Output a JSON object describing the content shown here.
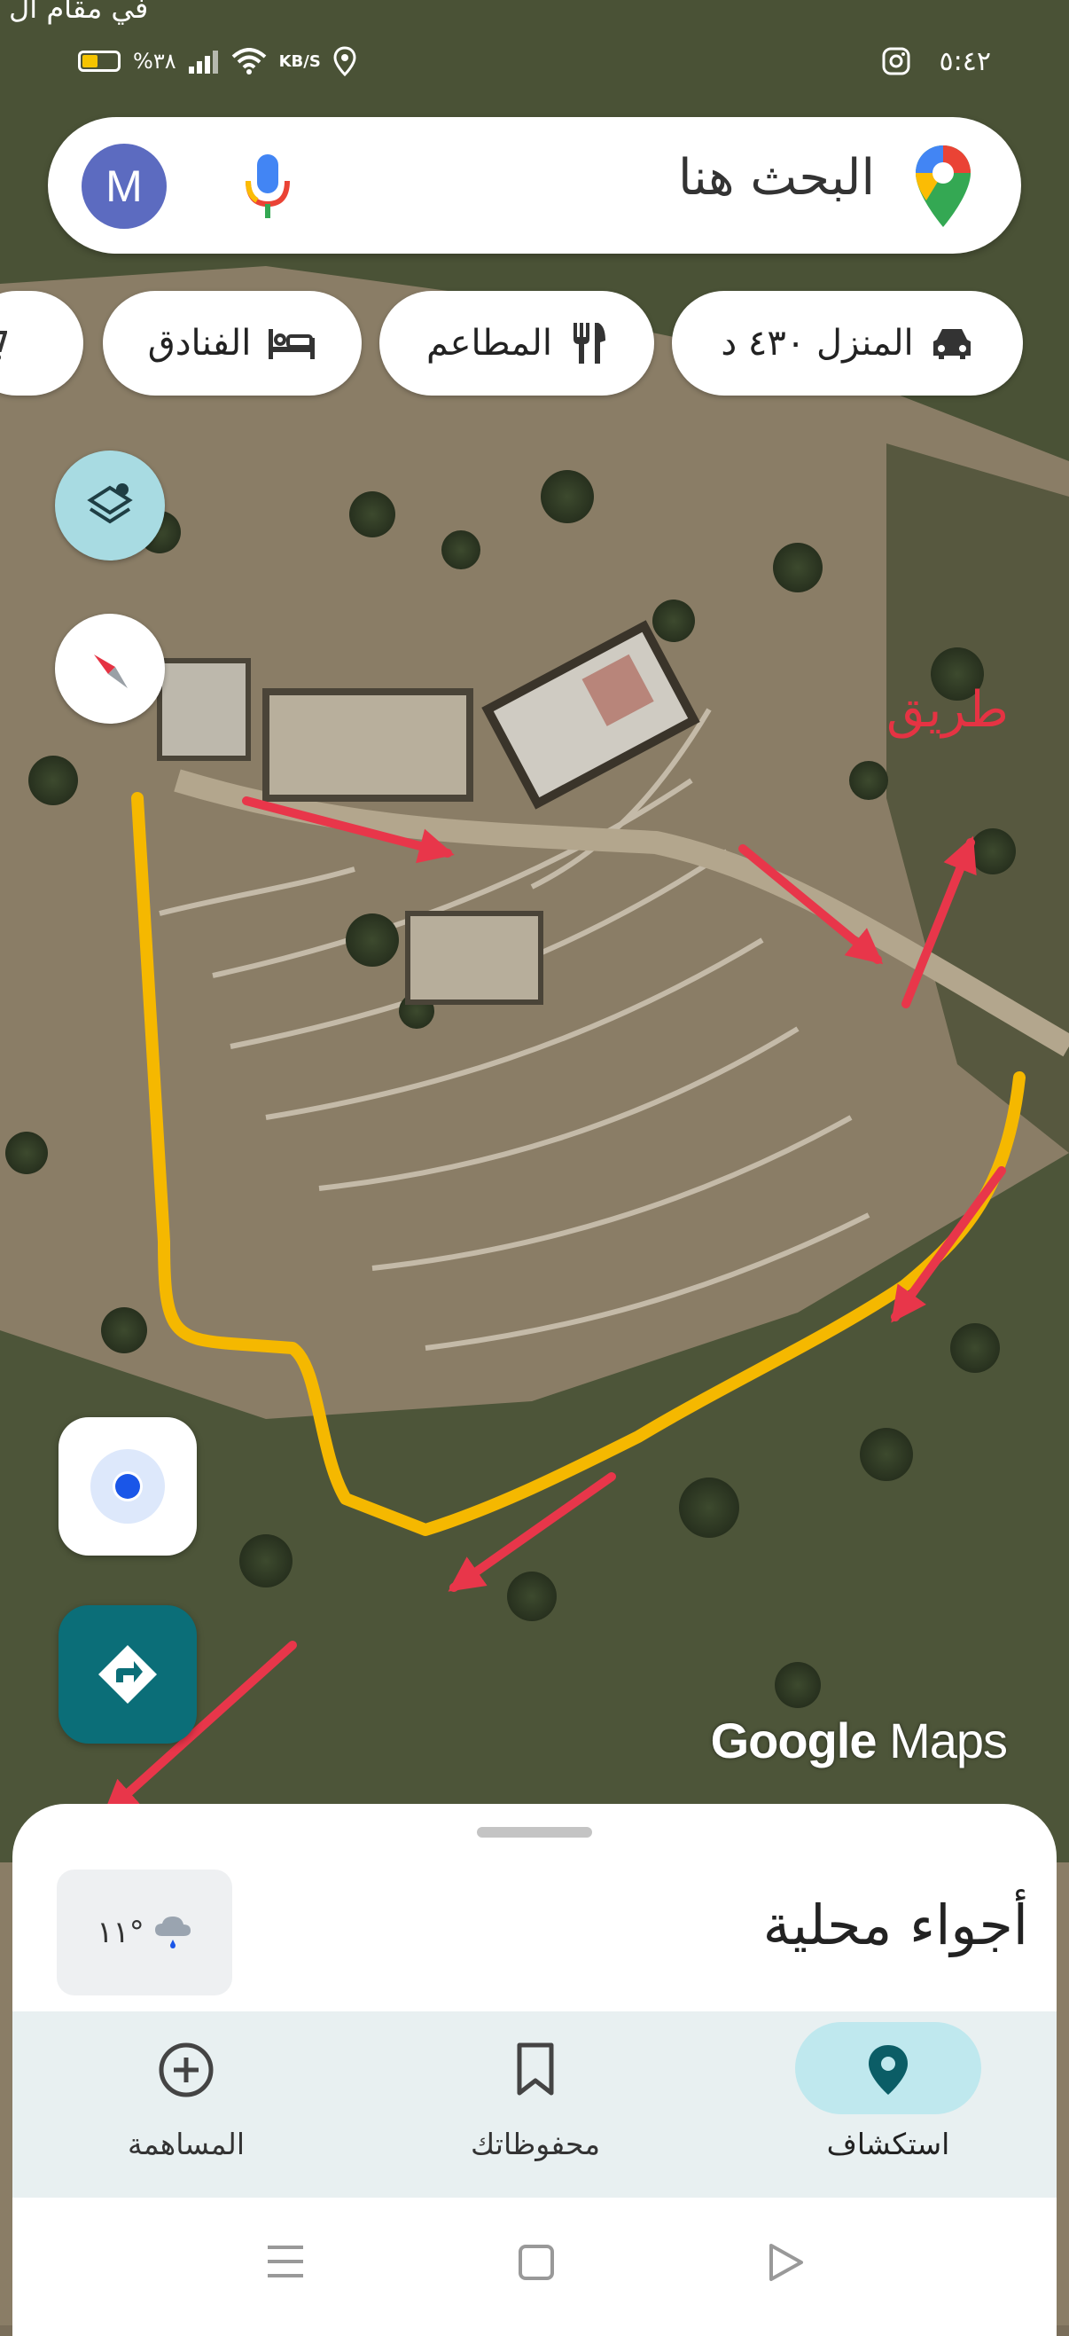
{
  "status_bar": {
    "time": "٥:٤٢",
    "network_speed": "KB/S",
    "battery_percent": "%٣٨",
    "corner_text": "في مقام ال"
  },
  "search": {
    "placeholder": "البحث هنا",
    "avatar_letter": "M"
  },
  "chips": [
    {
      "label": "المنزل ٤٣٠ د",
      "icon": "car-icon"
    },
    {
      "label": "المطاعم",
      "icon": "restaurant-icon"
    },
    {
      "label": "الفنادق",
      "icon": "hotel-icon"
    },
    {
      "label": "",
      "icon": "cart-icon"
    }
  ],
  "map": {
    "annotation_label": "طريق",
    "attribution": {
      "google": "Google",
      "maps": "Maps"
    },
    "colors": {
      "arrow": "#e8364a",
      "path": "#f5b800"
    }
  },
  "sheet": {
    "title": "أجواء محلية",
    "weather": "١١°",
    "weather_icon": "cloud-rain-icon"
  },
  "bottom_nav": [
    {
      "label": "استكشاف",
      "icon": "location-pin-icon",
      "active": true
    },
    {
      "label": "محفوظاتك",
      "icon": "bookmark-icon",
      "active": false
    },
    {
      "label": "المساهمة",
      "icon": "add-circle-icon",
      "active": false
    }
  ]
}
